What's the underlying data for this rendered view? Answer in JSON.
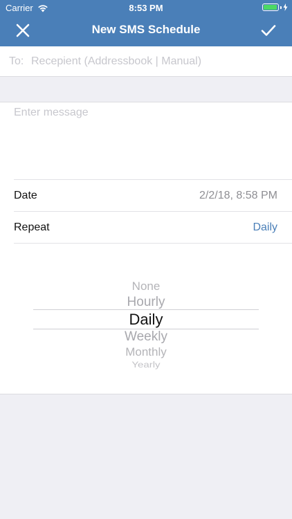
{
  "status_bar": {
    "carrier": "Carrier",
    "time": "8:53 PM",
    "battery_level": 1.0,
    "battery_color": "#4cd964"
  },
  "nav": {
    "title": "New SMS Schedule",
    "close_icon": "close-icon",
    "confirm_icon": "checkmark-icon",
    "background_color": "#4a7fb8"
  },
  "recipient": {
    "label": "To:",
    "value": "",
    "placeholder": "Recepient (Addressbook | Manual)"
  },
  "message": {
    "value": "",
    "placeholder": "Enter message"
  },
  "date_row": {
    "label": "Date",
    "value": "2/2/18, 8:58 PM"
  },
  "repeat_row": {
    "label": "Repeat",
    "value": "Daily",
    "value_color": "#4a7fb8"
  },
  "picker": {
    "options": [
      "None",
      "Hourly",
      "Daily",
      "Weekly",
      "Monthly",
      "Yearly"
    ],
    "selected": "Daily"
  }
}
